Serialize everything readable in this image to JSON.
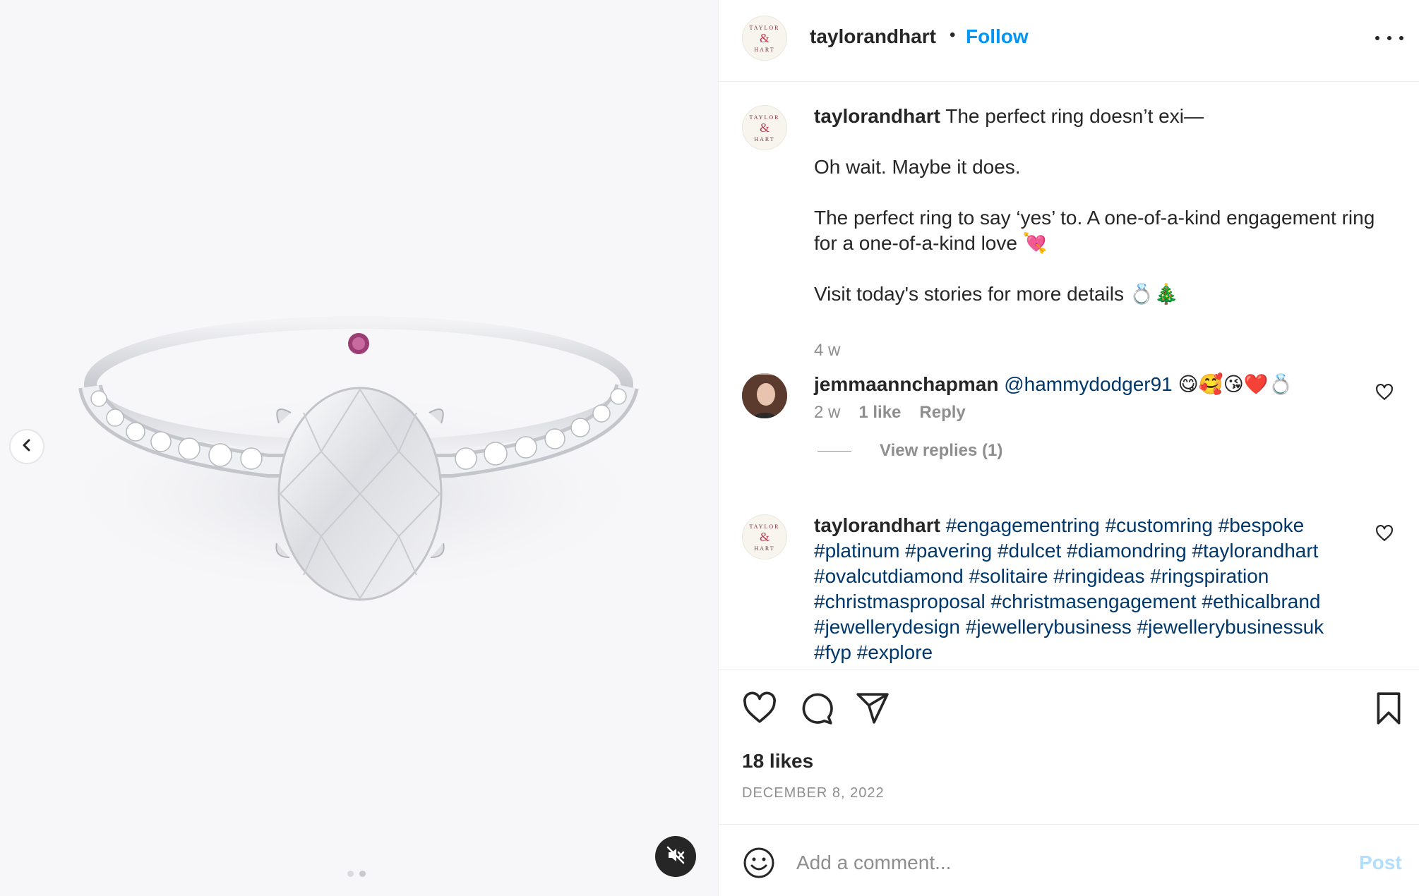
{
  "post": {
    "username": "taylorandhart",
    "separator": "•",
    "follow_label": "Follow",
    "logo_text": "TAYLOR & HART"
  },
  "caption": {
    "username": "taylorandhart",
    "line1": "The perfect ring doesn’t exi—",
    "line2": "Oh wait. Maybe it does.",
    "line3": "The perfect ring to say ‘yes’ to. A one-of-a-kind engagement ring for a one-of-a-kind love 💘",
    "line4": "Visit today's stories for more details 💍🎄",
    "age": "4 w"
  },
  "comment1": {
    "username": "jemmaannchapman",
    "mention": "@hammydodger91",
    "emojis": "😋🥰😘❤️💍",
    "age": "2 w",
    "likes": "1 like",
    "reply_label": "Reply",
    "view_replies": "View replies (1)"
  },
  "comment2": {
    "username": "taylorandhart",
    "hashtags": "#engagementring #customring #bespoke #platinum #pavering #dulcet #diamondring #taylorandhart #ovalcutdiamond #solitaire #ringideas #ringspiration #christmasproposal #christmasengagement #ethicalbrand #jewellerydesign #jewellerybusiness #jewellerybusinessuk #fyp #explore"
  },
  "actions": {
    "likes": "18 likes",
    "date": "DECEMBER 8, 2022"
  },
  "add_comment": {
    "placeholder": "Add a comment...",
    "post_label": "Post"
  },
  "icons": {
    "prev": "chevron-left-icon",
    "mute": "speaker-muted-icon",
    "more": "more-horizontal-icon",
    "like": "heart-icon",
    "comment": "comment-icon",
    "share": "send-icon",
    "save": "bookmark-icon",
    "emoji": "smiley-icon"
  },
  "colors": {
    "follow": "#0095f6",
    "hashtag": "#00376b",
    "post_disabled": "#b2dffc",
    "meta": "#8e8e8e"
  },
  "carousel": {
    "current": 2,
    "total": 2
  }
}
